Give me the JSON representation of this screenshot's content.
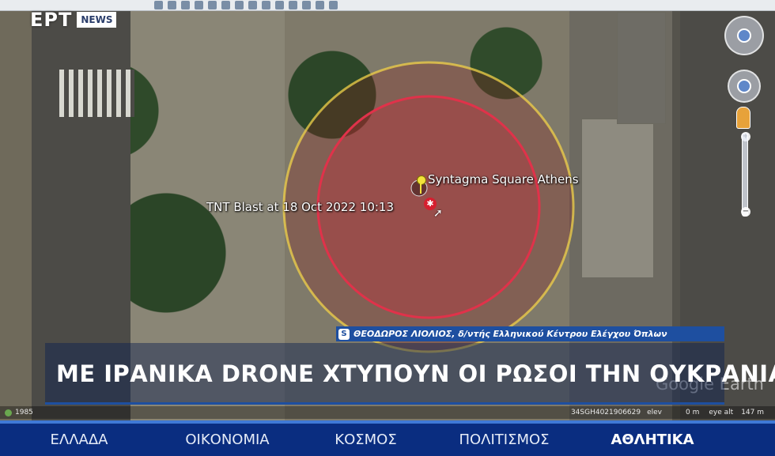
{
  "broadcaster": {
    "logo": "ЕРТ",
    "badge": "NEWS"
  },
  "map": {
    "place_label": "Syntagma Square Athens",
    "blast_label": "TNT Blast at 18 Oct 2022 10:13",
    "watermark": "Google Earth",
    "status": {
      "year": "1985",
      "coords": "34SGH4021906629",
      "elev_label": "elev",
      "elev_value": "0 m",
      "eye_label": "eye alt",
      "eye_value": "147 m"
    },
    "colors": {
      "inner_ring": "#e0324a",
      "outer_ring": "#f0d24a"
    }
  },
  "caption": {
    "icon": "S",
    "text": "ΘΕΟΔΩΡΟΣ ΛΙΟΛΙΟΣ, δ/ντής  Ελληνικού Κέντρου Ελέγχου Όπλων"
  },
  "headline": "ΜΕ ΙΡΑΝΙΚΑ DRONE ΧΤΥΠΟΥΝ ΟΙ ΡΩΣΟΙ ΤΗΝ ΟΥΚΡΑΝΙΑ",
  "nav": {
    "items": [
      {
        "label": "ΕΛΛΑΔΑ"
      },
      {
        "label": "ΟΙΚΟΝΟΜΙΑ"
      },
      {
        "label": "ΚΟΣΜΟΣ"
      },
      {
        "label": "ΠΟΛΙΤΙΣΜΟΣ"
      },
      {
        "label": "ΑΘΛΗΤΙΚΑ"
      }
    ],
    "active_index": 4,
    "bar_color": "#0a2d80"
  }
}
